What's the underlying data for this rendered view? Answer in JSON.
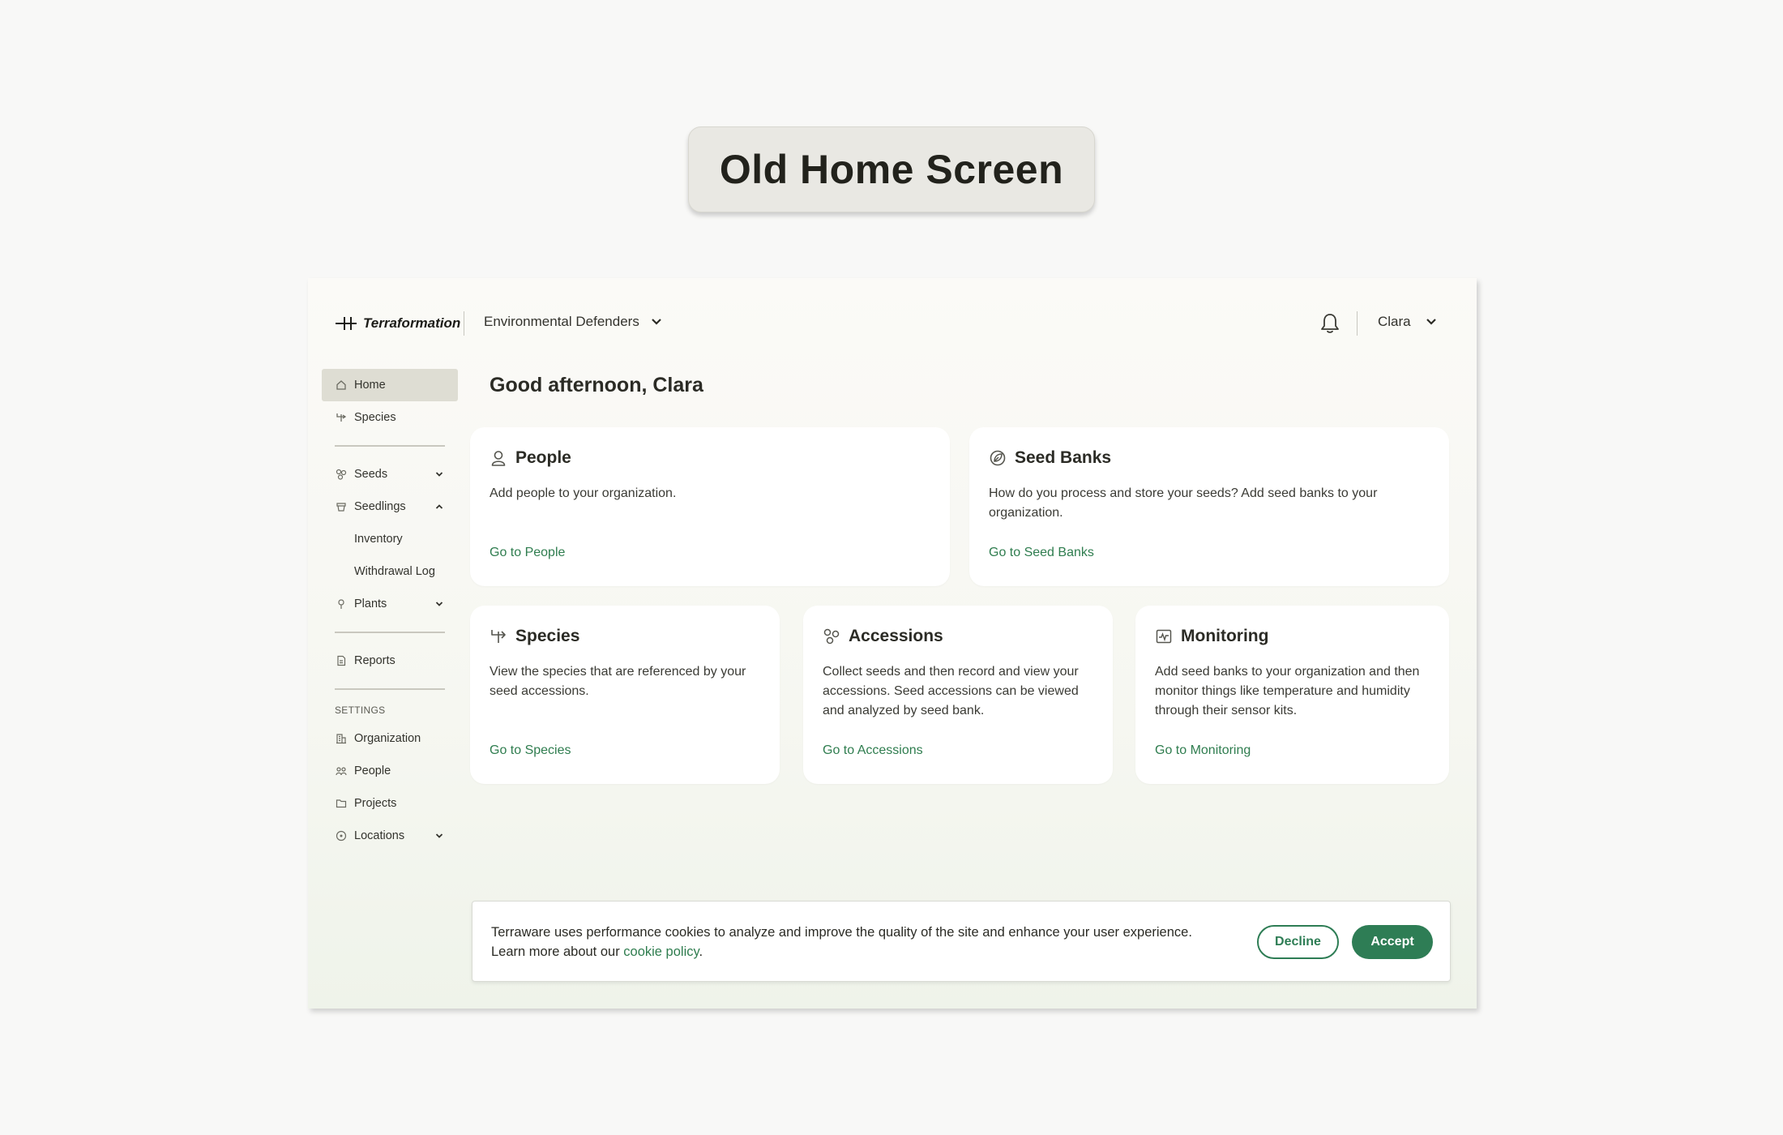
{
  "badge": {
    "title": "Old Home Screen"
  },
  "header": {
    "brand": "Terraformation",
    "org_name": "Environmental Defenders",
    "user_name": "Clara"
  },
  "sidebar": {
    "items": [
      {
        "label": "Home",
        "icon": "home-icon",
        "active": true
      },
      {
        "label": "Species",
        "icon": "species-icon"
      },
      {
        "label": "Seeds",
        "icon": "seeds-icon",
        "expandable": true
      },
      {
        "label": "Seedlings",
        "icon": "seedlings-icon",
        "expanded": true
      },
      {
        "label": "Inventory",
        "sub": true
      },
      {
        "label": "Withdrawal Log",
        "sub": true
      },
      {
        "label": "Plants",
        "icon": "plant-icon",
        "expandable": true
      },
      {
        "label": "Reports",
        "icon": "report-icon"
      }
    ],
    "settings_label": "SETTINGS",
    "settings_items": [
      {
        "label": "Organization",
        "icon": "organization-icon"
      },
      {
        "label": "People",
        "icon": "people-icon"
      },
      {
        "label": "Projects",
        "icon": "folder-icon"
      },
      {
        "label": "Locations",
        "icon": "location-icon",
        "expandable": true
      }
    ]
  },
  "main": {
    "greeting": "Good afternoon, Clara",
    "cards": [
      {
        "title": "People",
        "desc": "Add people to your organization.",
        "link": "Go to People"
      },
      {
        "title": "Seed Banks",
        "desc": "How do you process and store your seeds? Add seed banks to your organization.",
        "link": "Go to Seed Banks"
      },
      {
        "title": "Species",
        "desc": "View the species that are referenced by your seed accessions.",
        "link": "Go to Species"
      },
      {
        "title": "Accessions",
        "desc": "Collect seeds and then record and view your accessions. Seed accessions can be viewed and analyzed by seed bank.",
        "link": "Go to Accessions"
      },
      {
        "title": "Monitoring",
        "desc": "Add seed banks to your organization and then monitor things like temperature and humidity through their sensor kits.",
        "link": "Go to Monitoring"
      }
    ]
  },
  "cookie": {
    "text_line1": "Terraware uses performance cookies to analyze and improve the quality of the site and enhance your user experience.",
    "text_line2_prefix": "Learn more about our ",
    "link_text": "cookie policy",
    "text_line2_suffix": ".",
    "decline_label": "Decline",
    "accept_label": "Accept"
  },
  "colors": {
    "accent_green": "#2e7d55",
    "link_green": "#2f7d4f",
    "active_nav_bg": "#deddd3"
  }
}
